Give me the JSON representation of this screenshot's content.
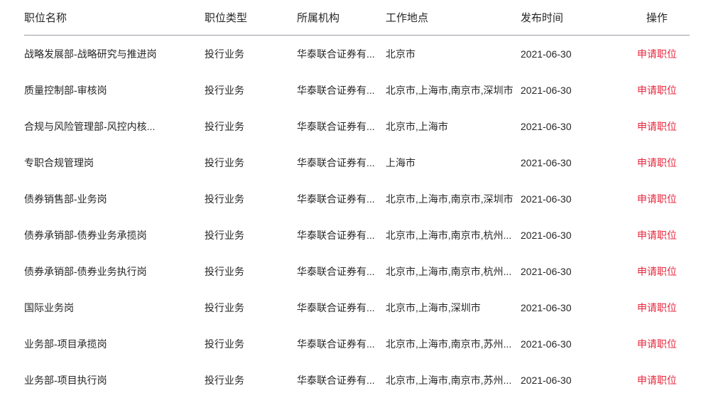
{
  "table": {
    "columns": [
      {
        "key": "name",
        "label": "职位名称"
      },
      {
        "key": "type",
        "label": "职位类型"
      },
      {
        "key": "org",
        "label": "所属机构"
      },
      {
        "key": "location",
        "label": "工作地点"
      },
      {
        "key": "date",
        "label": "发布时间"
      },
      {
        "key": "action",
        "label": "操作"
      }
    ],
    "action_label": "申请职位",
    "accent_color": "#e8263c",
    "text_color": "#262626",
    "divider_color": "#9a9aa2",
    "rows": [
      {
        "name": "战略发展部-战略研究与推进岗",
        "type": "投行业务",
        "org": "华泰联合证券有...",
        "location": "北京市",
        "date": "2021-06-30",
        "action": "申请职位"
      },
      {
        "name": "质量控制部-审核岗",
        "type": "投行业务",
        "org": "华泰联合证券有...",
        "location": "北京市,上海市,南京市,深圳市",
        "date": "2021-06-30",
        "action": "申请职位"
      },
      {
        "name": "合规与风险管理部-风控内核...",
        "type": "投行业务",
        "org": "华泰联合证券有...",
        "location": "北京市,上海市",
        "date": "2021-06-30",
        "action": "申请职位"
      },
      {
        "name": "专职合规管理岗",
        "type": "投行业务",
        "org": "华泰联合证券有...",
        "location": "上海市",
        "date": "2021-06-30",
        "action": "申请职位"
      },
      {
        "name": "债券销售部-业务岗",
        "type": "投行业务",
        "org": "华泰联合证券有...",
        "location": "北京市,上海市,南京市,深圳市",
        "date": "2021-06-30",
        "action": "申请职位"
      },
      {
        "name": "债券承销部-债券业务承揽岗",
        "type": "投行业务",
        "org": "华泰联合证券有...",
        "location": "北京市,上海市,南京市,杭州...",
        "date": "2021-06-30",
        "action": "申请职位"
      },
      {
        "name": "债券承销部-债券业务执行岗",
        "type": "投行业务",
        "org": "华泰联合证券有...",
        "location": "北京市,上海市,南京市,杭州...",
        "date": "2021-06-30",
        "action": "申请职位"
      },
      {
        "name": "国际业务岗",
        "type": "投行业务",
        "org": "华泰联合证券有...",
        "location": "北京市,上海市,深圳市",
        "date": "2021-06-30",
        "action": "申请职位"
      },
      {
        "name": "业务部-项目承揽岗",
        "type": "投行业务",
        "org": "华泰联合证券有...",
        "location": "北京市,上海市,南京市,苏州...",
        "date": "2021-06-30",
        "action": "申请职位"
      },
      {
        "name": "业务部-项目执行岗",
        "type": "投行业务",
        "org": "华泰联合证券有...",
        "location": "北京市,上海市,南京市,苏州...",
        "date": "2021-06-30",
        "action": "申请职位"
      }
    ]
  }
}
